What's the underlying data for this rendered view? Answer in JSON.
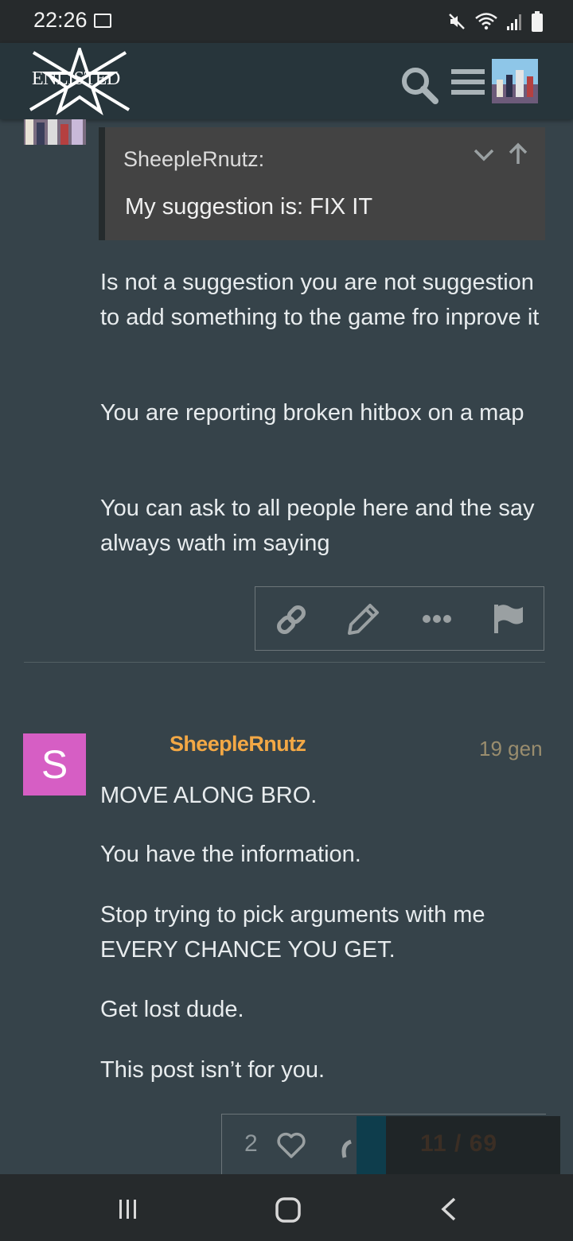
{
  "status_bar": {
    "time": "22:26"
  },
  "header": {
    "logo_text": "ENLISTED"
  },
  "quote": {
    "author": "SheepleRnutz:",
    "text": "My suggestion is: FIX IT"
  },
  "post1": {
    "paragraphs": [
      "Is not a suggestion you are not suggestion to add something to the game fro inprove it",
      "You are reporting broken hitbox on a map",
      "You can ask to all people here and the say always wath im saying"
    ]
  },
  "post2": {
    "avatar_letter": "S",
    "avatar_color": "#d65ec4",
    "username": "SheepleRnutz",
    "username_color": "#f3a845",
    "date": "19 gen",
    "paragraphs": [
      "MOVE ALONG BRO.",
      "You have the information.",
      "Stop trying to pick arguments with me EVERY CHANCE YOU GET.",
      "Get lost dude.",
      "This post isn’t for you."
    ],
    "like_count": "2"
  },
  "timeline": {
    "text": "11 / 69"
  },
  "icons": {
    "gallery": "image-icon",
    "mute": "mute-icon",
    "wifi": "wifi-icon",
    "signal": "signal-icon",
    "battery": "battery-icon",
    "search": "search-icon",
    "menu": "hamburger-menu-icon",
    "link": "link-icon",
    "edit": "pencil-icon",
    "more": "ellipsis-icon",
    "flag": "flag-icon",
    "like": "heart-icon"
  }
}
